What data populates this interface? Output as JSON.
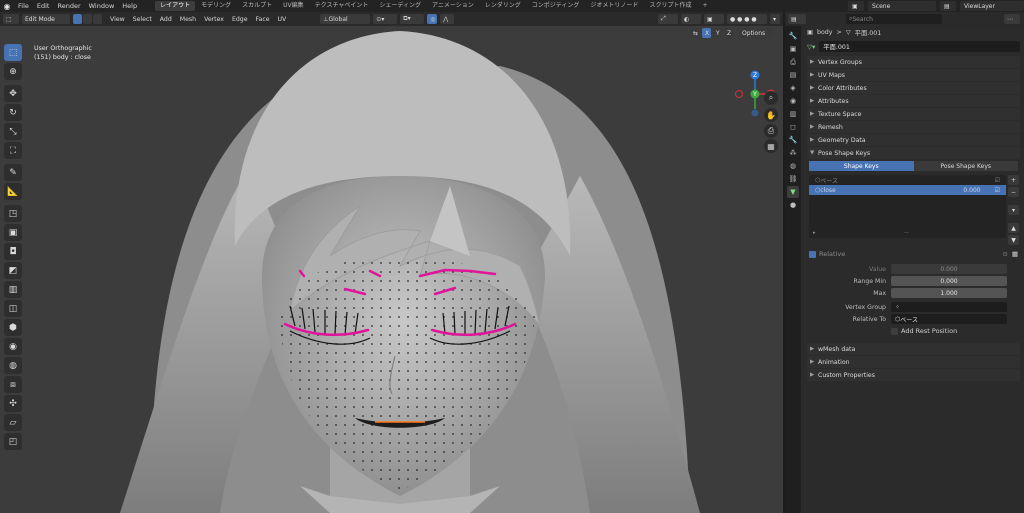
{
  "topbar": {
    "menus": [
      "File",
      "Edit",
      "Render",
      "Window",
      "Help"
    ],
    "workspaces": [
      "レイアウト",
      "モデリング",
      "スカルプト",
      "UV編集",
      "テクスチャペイント",
      "シェーディング",
      "アニメーション",
      "レンダリング",
      "コンポジティング",
      "ジオメトリノード",
      "スクリプト作成"
    ],
    "active_workspace": "レイアウト",
    "add_tab": "+",
    "scene": "Scene",
    "view_layer": "ViewLayer"
  },
  "viewport_header": {
    "mode": "Edit Mode",
    "menus": [
      "View",
      "Select",
      "Add",
      "Mesh",
      "Vertex",
      "Edge",
      "Face",
      "UV"
    ],
    "transform_orientation": "Global",
    "options": "Options",
    "axis_x": "X",
    "axis_y": "Y",
    "axis_z": "Z"
  },
  "viewport": {
    "view_name": "User Orthographic",
    "object_info": "(151) body : close",
    "gizmo_z": "Z",
    "gizmo_y": "Y",
    "gizmo_x": "X"
  },
  "properties": {
    "search_placeholder": "Search",
    "breadcrumb_object": "body",
    "breadcrumb_sep": ">",
    "breadcrumb_mesh": "平面.001",
    "mesh_name": "平面.001",
    "panels_top": [
      "Vertex Groups",
      "UV Maps",
      "Color Attributes",
      "Attributes",
      "Texture Space",
      "Remesh",
      "Geometry Data"
    ],
    "shape_keys_panel": "Pose Shape Keys",
    "subtab_left": "Shape Keys",
    "subtab_right": "Pose Shape Keys",
    "keys": [
      {
        "name": "ベース",
        "value": ""
      },
      {
        "name": "close",
        "value": "0.000"
      }
    ],
    "relative_label": "Relative",
    "value_label": "Value",
    "value": "0.000",
    "range_min_label": "Range Min",
    "range_min": "0.000",
    "max_label": "Max",
    "max": "1.000",
    "vertex_group_label": "Vertex Group",
    "relative_to_label": "Relative To",
    "relative_to": "ベース",
    "add_rest_position": "Add Rest Position",
    "panels_bottom": [
      "wMesh data",
      "Animation",
      "Custom Properties"
    ]
  },
  "colors": {
    "accent": "#4772b3",
    "seam_magenta": "#e0149a",
    "vertex_black": "#111111",
    "selected_orange": "#ff7a1a"
  }
}
